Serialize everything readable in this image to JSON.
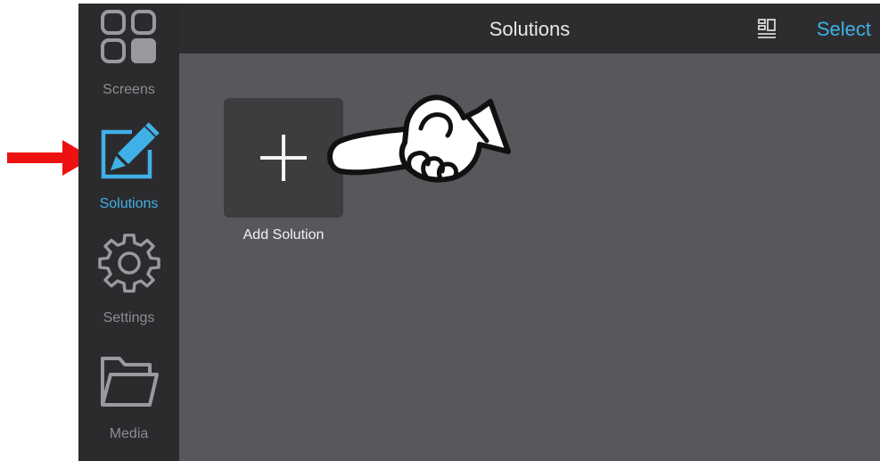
{
  "sidebar": {
    "items": [
      {
        "label": "Screens",
        "icon": "screens-grid-icon"
      },
      {
        "label": "Solutions",
        "icon": "edit-pencil-icon",
        "active": true
      },
      {
        "label": "Settings",
        "icon": "gear-icon"
      },
      {
        "label": "Media",
        "icon": "folder-icon"
      }
    ]
  },
  "header": {
    "title": "Solutions",
    "layout_icon": "layout-toggle-icon",
    "select_label": "Select"
  },
  "main": {
    "add_tile_label": "Add Solution",
    "add_icon": "plus-icon"
  },
  "annotations": {
    "red_arrow": "arrow-right-icon",
    "pointing_hand": "pointing-hand-icon"
  },
  "colors": {
    "accent": "#3fb1e6",
    "sidebar_bg": "#2b2b2d",
    "content_bg": "#58585c",
    "arrow": "#ee1111"
  }
}
